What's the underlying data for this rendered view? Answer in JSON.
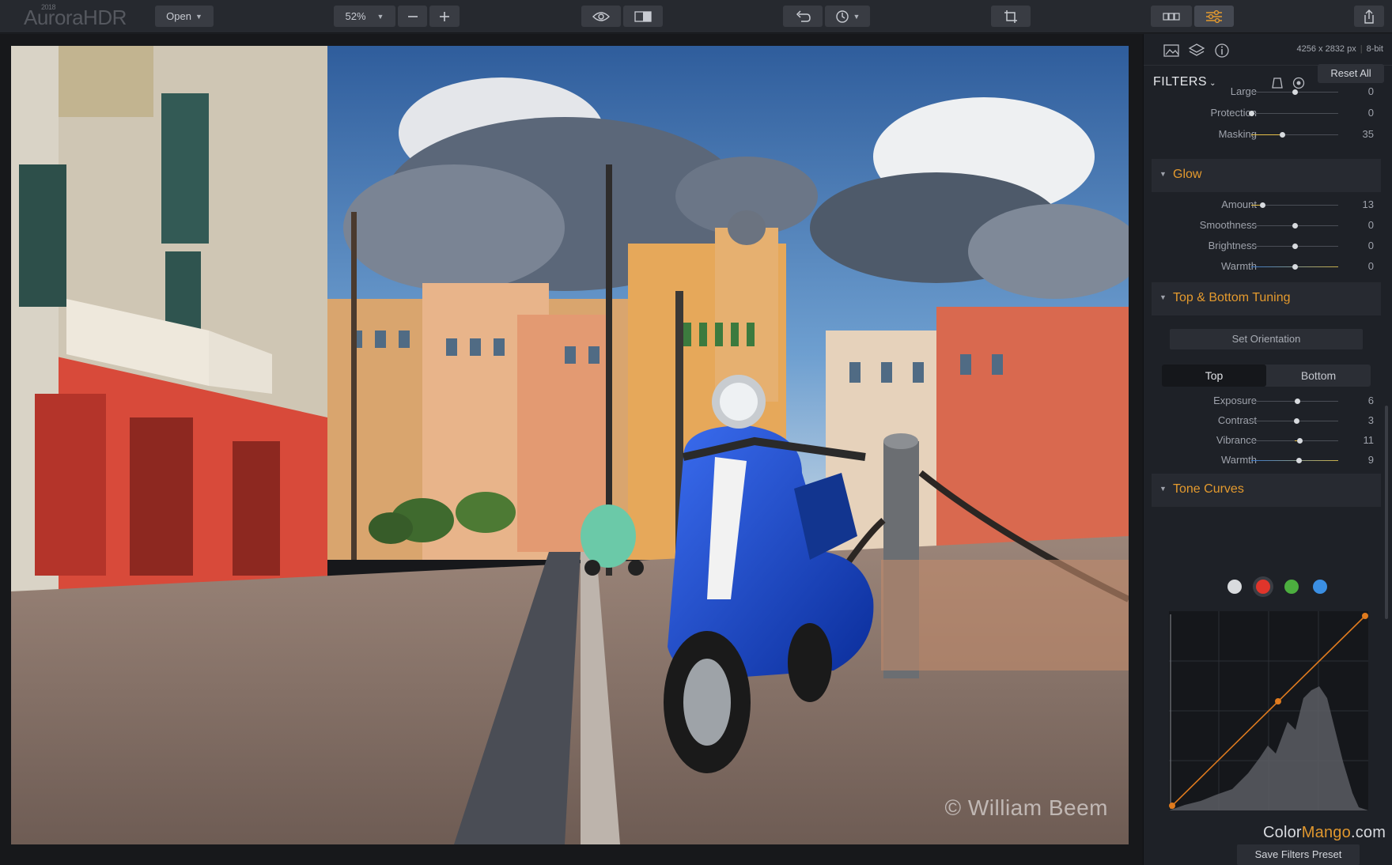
{
  "app": {
    "logo": "AuroraHDR",
    "logo_year": "2018"
  },
  "toolbar": {
    "open_label": "Open",
    "zoom": "52%",
    "icons": [
      "minus-icon",
      "plus-icon",
      "eye-icon",
      "compare-icon",
      "undo-icon",
      "history-icon",
      "crop-icon",
      "layout-icon",
      "filters-adjust-icon",
      "share-icon"
    ]
  },
  "canvas": {
    "watermark": "© William Beem"
  },
  "panel": {
    "image_size": "4256 x 2832 px",
    "bit_depth": "8-bit",
    "filters_title": "FILTERS",
    "reset_label": "Reset All",
    "top_sliders": [
      {
        "label": "Large",
        "value": "0",
        "pos": 0.5
      },
      {
        "label": "Protection",
        "value": "0",
        "pos": 0.0
      },
      {
        "label": "Masking",
        "value": "35",
        "pos": 0.35
      }
    ],
    "glow": {
      "title": "Glow",
      "sliders": [
        {
          "label": "Amount",
          "value": "13",
          "pos": 0.13
        },
        {
          "label": "Smoothness",
          "value": "0",
          "pos": 0.5
        },
        {
          "label": "Brightness",
          "value": "0",
          "pos": 0.5
        },
        {
          "label": "Warmth",
          "value": "0",
          "pos": 0.5
        }
      ]
    },
    "tuning": {
      "title": "Top & Bottom Tuning",
      "set_orientation": "Set Orientation",
      "tab_top": "Top",
      "tab_bottom": "Bottom",
      "sliders": [
        {
          "label": "Exposure",
          "value": "6",
          "pos": 0.53
        },
        {
          "label": "Contrast",
          "value": "3",
          "pos": 0.515
        },
        {
          "label": "Vibrance",
          "value": "11",
          "pos": 0.555
        },
        {
          "label": "Warmth",
          "value": "9",
          "pos": 0.545
        }
      ]
    },
    "curves": {
      "title": "Tone Curves",
      "channels": [
        "#d9dbde",
        "#e0352b",
        "#4cae3f",
        "#3b8fe3"
      ],
      "selected_channel": 1,
      "accent": "#e07b1e"
    },
    "save_preset": "Save Filters Preset"
  },
  "brand": {
    "color": "Color",
    "mid": "Mango",
    "dot": ".com"
  },
  "colors": {
    "accent": "#e49a2e",
    "panel_bg": "#1e2127",
    "toolbar_bg": "#26292f"
  }
}
